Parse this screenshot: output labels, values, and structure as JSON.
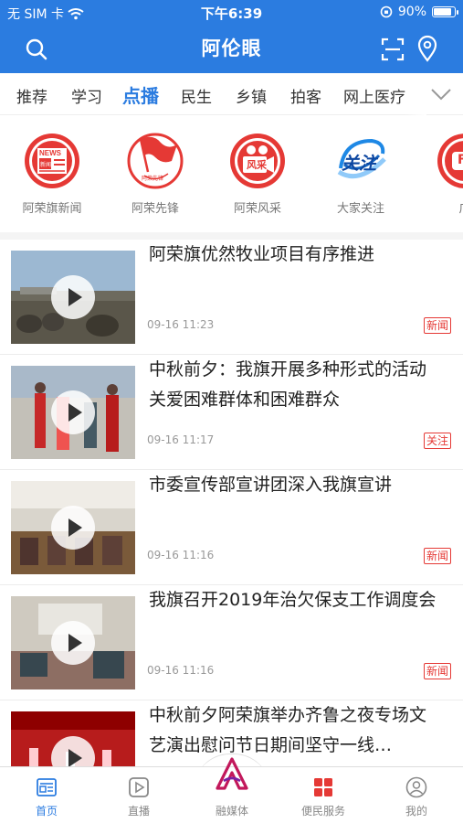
{
  "status_bar": {
    "carrier": "无 SIM 卡",
    "time": "下午6:39",
    "battery": "90%",
    "battery_level": 0.9
  },
  "nav": {
    "title": "阿伦眼",
    "search_icon": "search-icon",
    "scan_icon": "scan-icon",
    "location_icon": "location-pin-icon"
  },
  "tabs": [
    "推荐",
    "学习",
    "点播",
    "民生",
    "乡镇",
    "拍客",
    "网上医疗"
  ],
  "active_tab": "点播",
  "channels": [
    {
      "label": "阿荣旗新闻",
      "icon": "news-icon",
      "badge": "NEWS",
      "badge2": "新闻",
      "color": "#e53935"
    },
    {
      "label": "阿荣先锋",
      "icon": "flag-icon",
      "badge": "阿荣先锋",
      "color": "#e53935"
    },
    {
      "label": "阿荣风采",
      "icon": "camera-icon",
      "badge": "风采",
      "color": "#e53935"
    },
    {
      "label": "大家关注",
      "icon": "focus-icon",
      "badge": "关注",
      "color": "#1e88e5"
    },
    {
      "label": "广",
      "icon": "broadcast-icon",
      "badge": "F",
      "color": "#e53935"
    }
  ],
  "news": [
    {
      "title": "阿荣旗优然牧业项目有序推进",
      "time": "09-16 11:23",
      "tag": "新闻"
    },
    {
      "title": "中秋前夕：我旗开展多种形式的活动 关爱困难群体和困难群众",
      "time": "09-16 11:17",
      "tag": "关注"
    },
    {
      "title": "市委宣传部宣讲团深入我旗宣讲",
      "time": "09-16 11:16",
      "tag": "新闻"
    },
    {
      "title": "我旗召开2019年治欠保支工作调度会",
      "time": "09-16 11:16",
      "tag": "新闻"
    },
    {
      "title": "中秋前夕阿荣旗举办齐鲁之夜专场文艺演出慰问节日期间坚守一线…",
      "time": "",
      "tag": ""
    }
  ],
  "bottom_tabs": [
    {
      "label": "首页",
      "icon": "home-icon"
    },
    {
      "label": "直播",
      "icon": "live-icon"
    },
    {
      "label": "融媒体",
      "icon": "media-logo-icon"
    },
    {
      "label": "便民服务",
      "icon": "services-grid-icon"
    },
    {
      "label": "我的",
      "icon": "profile-icon"
    }
  ],
  "colors": {
    "brand": "#2b7ce0",
    "tag": "#e53935"
  }
}
